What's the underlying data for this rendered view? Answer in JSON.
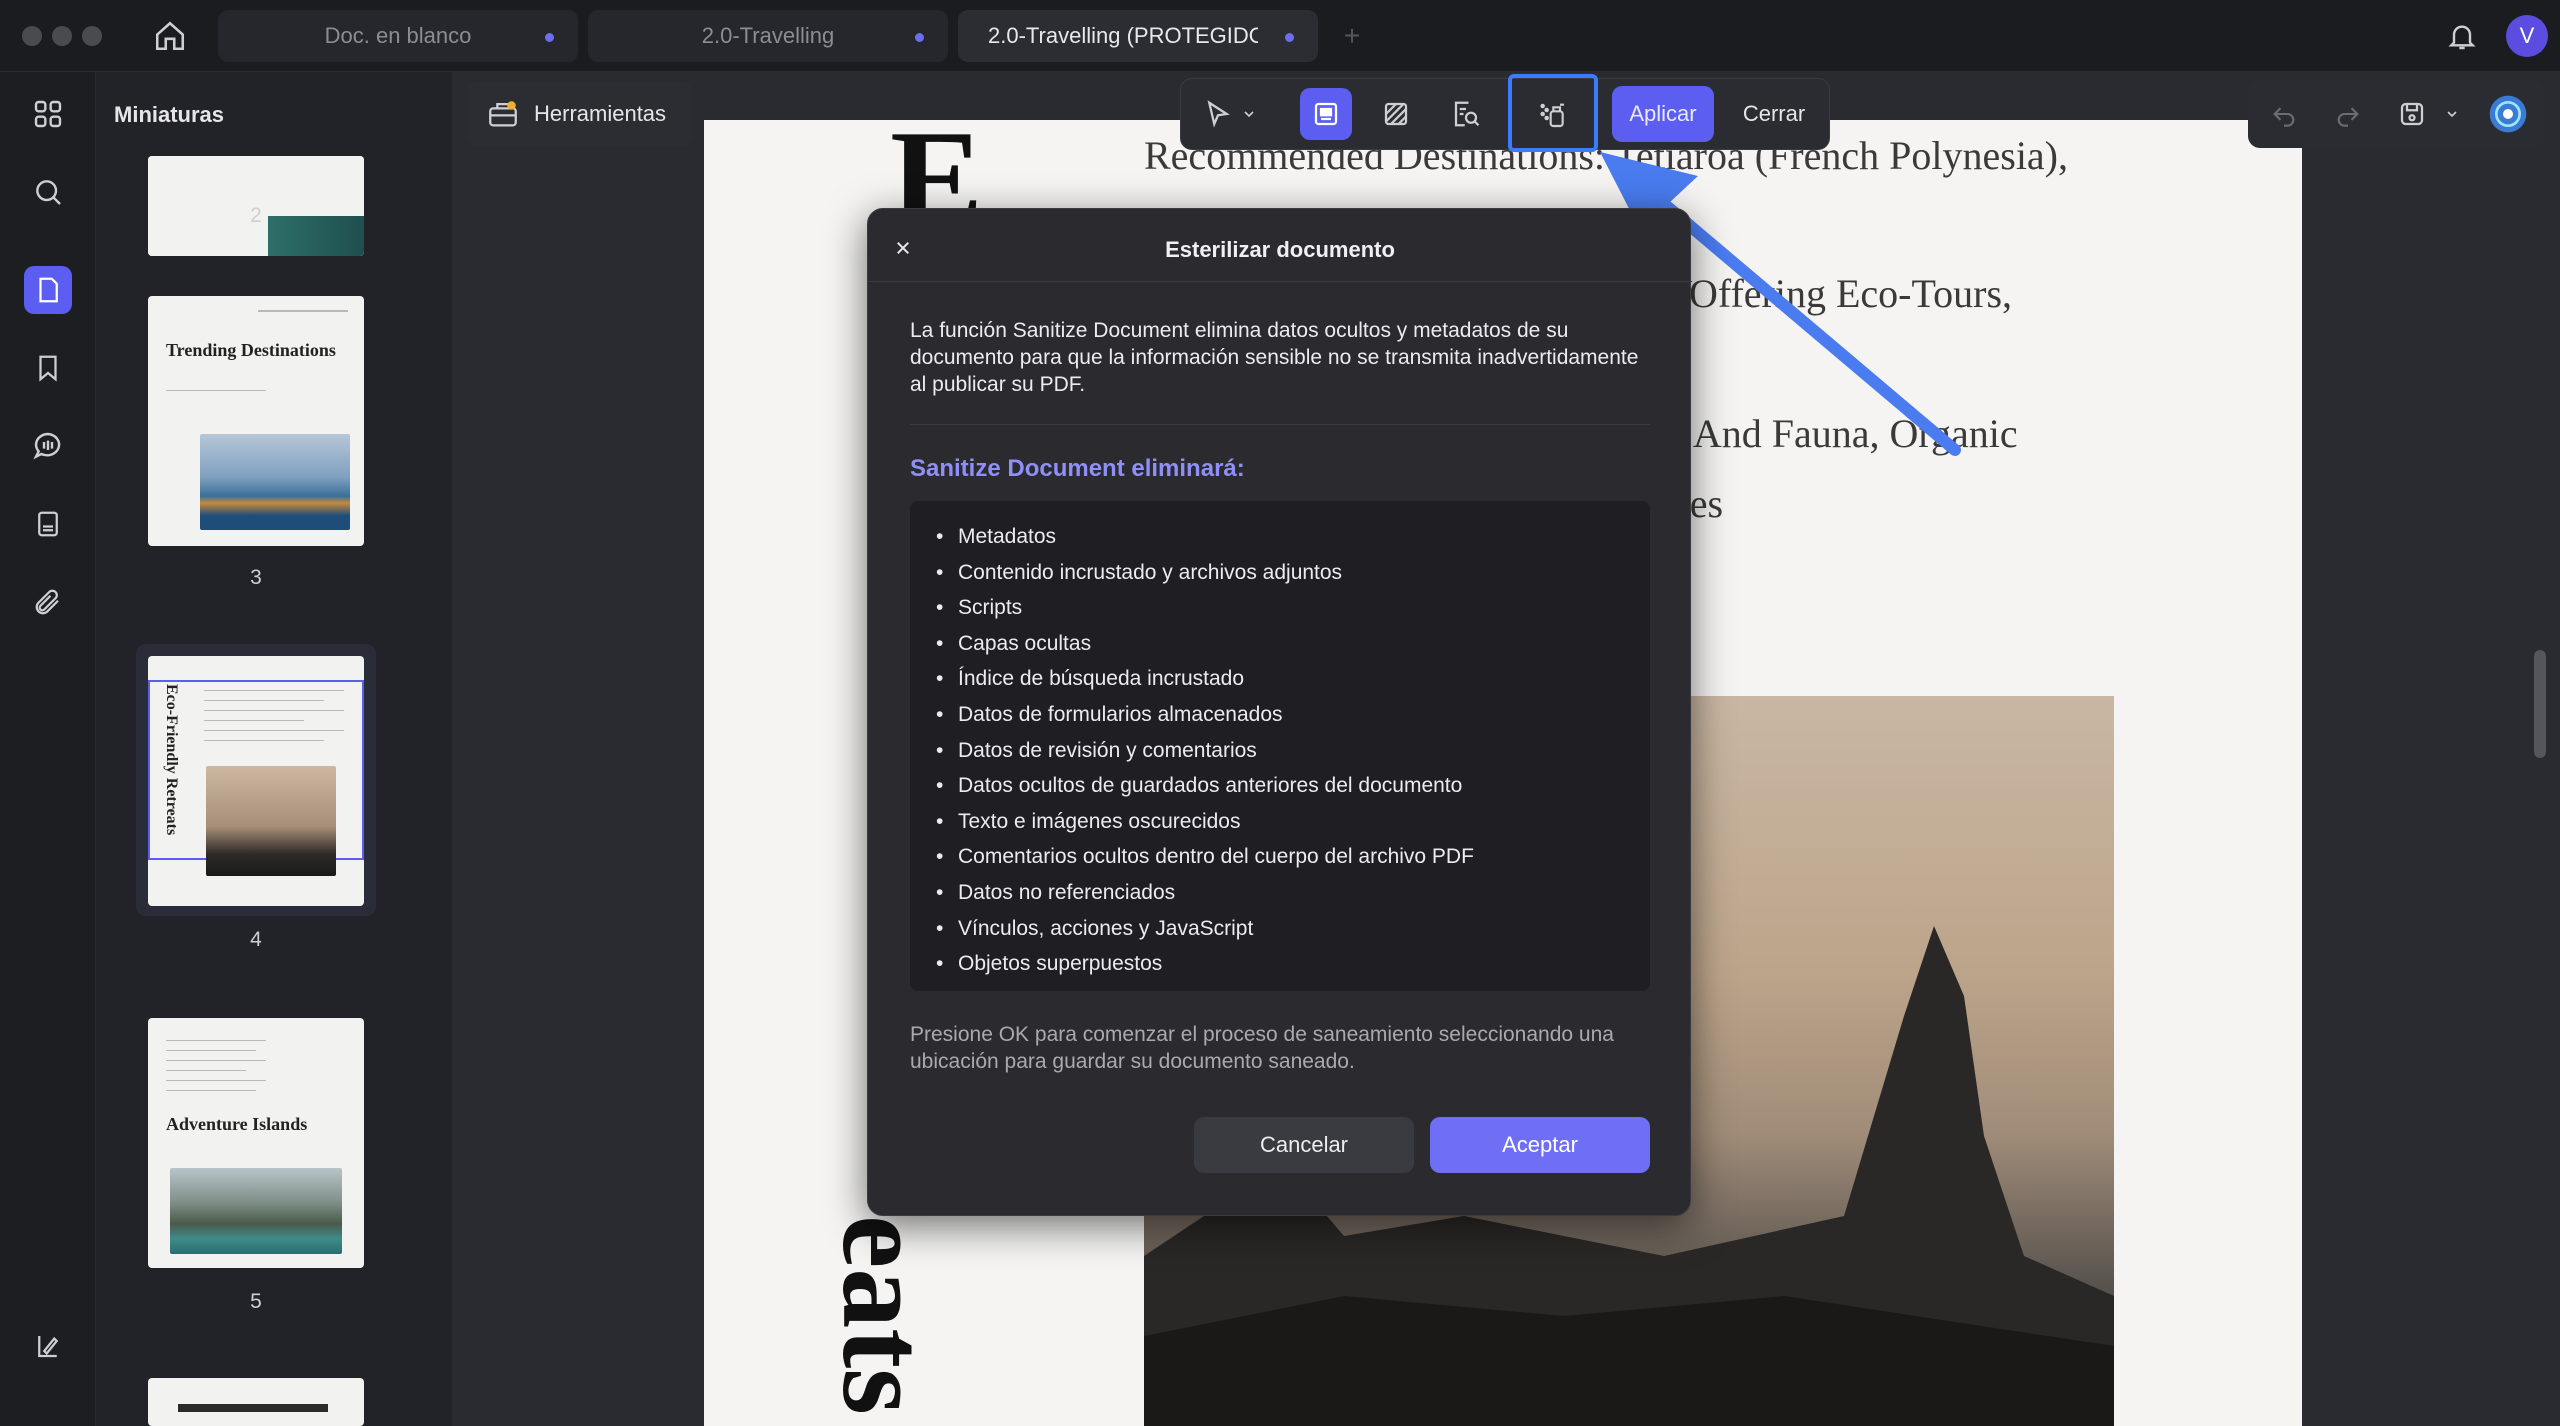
{
  "tabs": [
    {
      "label": "Doc. en blanco"
    },
    {
      "label": "2.0-Travelling"
    },
    {
      "label": "2.0-Travelling (PROTEGIDO"
    }
  ],
  "avatar": {
    "initial": "V"
  },
  "thumbnails": {
    "title": "Miniaturas",
    "pages": [
      {
        "number": "2"
      },
      {
        "number": "3",
        "title": "Trending Destinations"
      },
      {
        "number": "4",
        "title": "Eco-Friendly Retreats"
      },
      {
        "number": "5",
        "title": "Adventure Islands"
      }
    ]
  },
  "toolbar": {
    "tools_label": "Herramientas",
    "apply_label": "Aplicar",
    "close_label": "Cerrar"
  },
  "document": {
    "line1": "Recommended Destinations: Tetiaroa (French Polynesia),",
    "line2": "Offering Eco-Tours,",
    "line3": "ra And Fauna, Organic",
    "line4": "ces",
    "big_letter_top": "E",
    "big_text_bottom": "eats"
  },
  "dialog": {
    "title": "Esterilizar documento",
    "description": "La función Sanitize Document elimina datos ocultos y metadatos de su documento para que la información sensible no se transmita inadvertidamente al publicar su PDF.",
    "subtitle": "Sanitize Document eliminará:",
    "items": [
      "Metadatos",
      "Contenido incrustado y archivos adjuntos",
      "Scripts",
      "Capas ocultas",
      "Índice de búsqueda incrustado",
      "Datos de formularios almacenados",
      "Datos de revisión y comentarios",
      "Datos ocultos de guardados anteriores del documento",
      "Texto e imágenes oscurecidos",
      "Comentarios ocultos dentro del cuerpo del archivo PDF",
      "Datos no referenciados",
      "Vínculos, acciones y JavaScript",
      "Objetos superpuestos"
    ],
    "note": "Presione OK para comenzar el proceso de saneamiento seleccionando una ubicación para guardar su documento saneado.",
    "cancel_label": "Cancelar",
    "ok_label": "Aceptar"
  },
  "colors": {
    "accent": "#5b5ef0",
    "highlight": "#3b7bff",
    "subtitle": "#8f8ff8"
  }
}
